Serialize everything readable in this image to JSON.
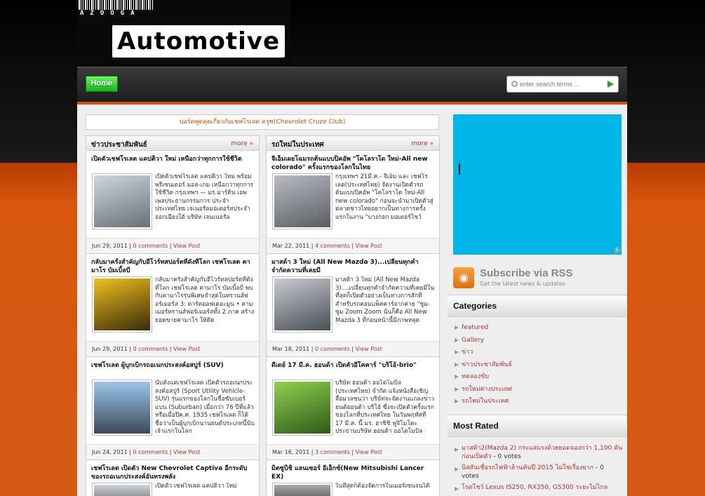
{
  "brand": {
    "small": "AZOOGA",
    "main": "Automotive"
  },
  "nav": {
    "home": "Home"
  },
  "search": {
    "placeholder": "enter search terms ..."
  },
  "main": {
    "cruze_link": "บอร์ดพูดคุยเกี่ยวกับเชฟโรเลต ครูซ(Chevrolet Cruze Club)",
    "columns": [
      {
        "title": "ข่าวประชาสัมพันธ์",
        "more": "more »",
        "posts": [
          {
            "title": "เปิดตัวเชฟโรเลต แคปติวา ใหม่ เหนือกว่าทุกการใช้ชีวิต",
            "excerpt": "เปิดตัวเชฟโรเลต แคปติวา ใหม่ พร้อมพรีเซนเตอร์ มอส-เกม เหนือกว่าทุกการใช้ชีวิต กรุงเทพฯ — มร.มาร์ติน เอพเพลประธานกรรมการ ประจำประเทศไทย เจเนอรัลมอเตอร์สประจำออกเฉียงใต้ บริษัท เจนเนอรัล",
            "date": "Jun 29, 2011",
            "comments": "0 comments",
            "view": "View Post",
            "img": [
              "#cfd6dc",
              "#6b6f78"
            ]
          },
          {
            "title": "กลับมาครั้งสำคัญกับอีโวร์ทสปอร์ตที่ดังที่โลก เชฟโรเลต คามาโร บัมเบิ้ลบี",
            "excerpt": "กลับมาครั้งสำคัญกับอีโวร์ทสปอร์ตที่ดังที่โลก เชฟโรเลต คามาโร บัมเบิ้ลบี พบกับคามาโรรุ่นพิเศษจำสุดในทรานส์ฟอร์เมอร์ส 3: ดาร์คออฟเดอะมูน • คามเมอร์ทรานส์ฟอร์เมอร์สทั้ง 2 ภาค สร้างยอดขายคามาโร ให้ติด",
            "date": "Jun 29, 2011",
            "comments": "0 comments",
            "view": "View Post",
            "img": [
              "#d9a810",
              "#3a2a08"
            ]
          },
          {
            "title": "เชฟโรเลต ผู้บุกเบิกรถอเนกประสงค์อสปูร์ (SUV)",
            "excerpt": "นับตั้งแต่เชฟโรเลต เปิดตัวรถอเนกประสงค์อสปูร์ (Sport Utility Vehicle-SUV) รุ่นแรกของโลกในชื่อซับเบอร์แบน (Suburban) เมื่อกว่า 76 ปีที่แล้ว หรือเมื่อปีค.ศ. 1935 เชฟโรเลต ก็ได้ชื่อว่าเป็นผู้บุกเบิกนานยนต์ประเภทนี้นับเจ้าแรกในโลก",
            "date": "Jun 24, 2011",
            "comments": "0 comments",
            "view": "View Post",
            "img": [
              "#9cc4e8",
              "#3b4b5a"
            ]
          }
        ]
      },
      {
        "title": "รถใหม่ในประเทศ",
        "more": "more »",
        "posts": [
          {
            "title": "จีเอ็มเผยโฉมรถต้นแบบปิคอัพ \"โคโลราโด ใหม่-All new colorado\" ครั้งแรกของโลกในไทย",
            "excerpt": "กรุงเทพฯ 21มี.ค.- จีเอ็ม และ เชฟโรเลต(ประเทศไทย) จัดงานเปิดตัวรถต้นแบบปิคอัพ \"โคโลราโด ใหม่-All new colorado\" ก่อนจะนำมาเปิดตัวสู่ตลาดชาวไทยอยากเป็นทางการครั้งแรกในงาน \"บางกอก มอเตอร์โชว์",
            "date": "Mar 22, 2011",
            "comments": "4 comments",
            "view": "View Post",
            "img": [
              "#b8bcc0",
              "#5a5c60"
            ]
          },
          {
            "title": "มาสด้า 3 ใหม่ (All New Mazda 3)...เปลี่ยนทุกคำจำกัดความที่เคยมี",
            "excerpt": "มาสด้า 3 ใหม่ (All New Mazda 3)....เปลี่ยนทุกคำจำกัดความที่เคยมีในที่สุดก็เปิดตัวอย่างเป็นทางการสักที สำหรับรถคอมแพ็คคาร์จากค่าย \"ซูม-ซูม Zoom Zoom นั่นก็คือ All New Mazda 3 ที่ก่อนหน้านี้มีภาพหลุด",
            "date": "Mar 18, 2011",
            "comments": "0 comments",
            "view": "View Post",
            "img": [
              "#c8ccd0",
              "#4a4e56"
            ]
          },
          {
            "title": "ดีเดย์ 17 มี.ค. ฮอนด้า เปิดตัวอีโคคาร์ \"บริโอ้-brio\"",
            "excerpt": "บริษัท ฮอนด้า ออโตโมบิล (ประเทศไทย) จำกัด แจ้งหนังสือเชิญสื่อมวลชนว่า บริษัทจะจัดงานแถลงข่าวยนต์ฮอนด้า บริโอ้ ซึ่งจะเปิดตัวครั้งแรกของโลกที่ประเทศไทย ในวันพฤหัสที่ 17 มี.ค. นี้ มร. ฮาชิชิ ฟูจิโมโตะ ประธานบริษัท ฮอนด้า ออโตโมบิล (ประเทศ",
            "date": "Mar 16, 2011",
            "comments": "3 comments",
            "view": "View Post",
            "img": [
              "#8fd050",
              "#2f5a18"
            ]
          }
        ]
      }
    ],
    "partial_posts": [
      {
        "title": "เชฟโรเลต เปิดตัว New Chevrolet Captiva อีกระดับของรถอเนกประสงค์อันทรงพลัง",
        "excerpt": "เปิดตัว เชฟโรเลต แคปติวา ใหม่"
      },
      {
        "title": "มิตซูบิชิ แลนเซอร์ อีเอ็กซ์(New Mitsubishi Lancer EX)",
        "excerpt": "ในที่สุดก็ต้องจัดการในเมอร์เซนจนได้"
      }
    ]
  },
  "sidebar": {
    "rss": {
      "title": "Subscribe via RSS",
      "sub": "Get the latest news & updates",
      "icon": "rss-icon"
    },
    "categories_title": "Categories",
    "categories": [
      "featured",
      "Gallery",
      "ข่าว",
      "ข่าวประชาสัมพันธ์",
      "ทดลองขับ",
      "รถใหม่ต่างประเทศ",
      "รถใหม่ในประเทศ"
    ],
    "most_rated_title": "Most Rated",
    "most_rated": [
      {
        "title": "มาสด้า2(Mazda 2) กระแสแรงด้วยยอดจองกว่า 1,100 คัน ก่อนเปิดตัว",
        "votes": "- 0 votes"
      },
      {
        "title": "นิสสันเชื่อรถไฟฟ้าล้านคันปี 2015 ไม่ใช่เรื่องยาก",
        "votes": "- 0 votes"
      },
      {
        "title": "โรดโชว์ Lexus IS250, RX350, GS300 ระยะไม่ไกล",
        "votes": ""
      }
    ]
  },
  "colors": {
    "accent": "#aa3333",
    "orange": "#d45a16",
    "ad": "#00b6e8"
  }
}
